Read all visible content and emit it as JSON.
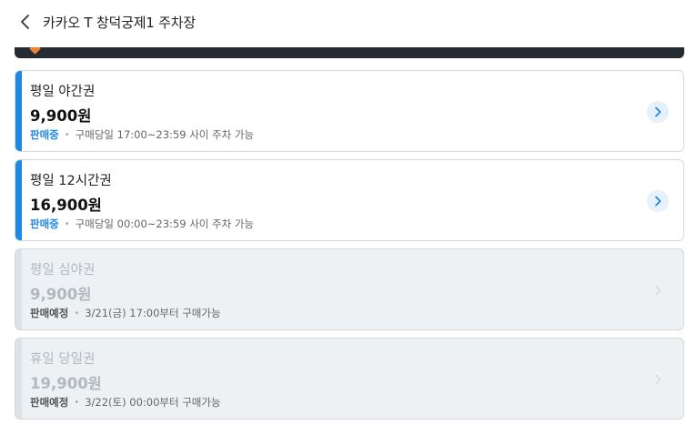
{
  "header": {
    "title": "카카오 T 창덕궁제1 주차장",
    "back_icon": "chevron-left-icon"
  },
  "tickets": [
    {
      "name": "평일 야간권",
      "price": "9,900원",
      "status": "판매중",
      "description": "구매당일 17:00~23:59 사이 주차 가능",
      "available": true
    },
    {
      "name": "평일 12시간권",
      "price": "16,900원",
      "status": "판매중",
      "description": "구매당일 00:00~23:59 사이 주차 가능",
      "available": true
    },
    {
      "name": "평일 심야권",
      "price": "9,900원",
      "status": "판매예정",
      "description": "3/21(금) 17:00부터 구매가능",
      "available": false
    },
    {
      "name": "휴일 당일권",
      "price": "19,900원",
      "status": "판매예정",
      "description": "3/22(토) 00:00부터 구매가능",
      "available": false
    }
  ],
  "colors": {
    "accent": "#1e88e5",
    "banner": "#242b33",
    "disabled_bg": "#eef1f4"
  }
}
